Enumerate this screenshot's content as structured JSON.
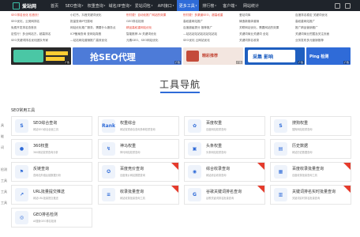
{
  "nav": {
    "logo": "爱站网",
    "items": [
      {
        "label": "首页",
        "active": false,
        "caret": false
      },
      {
        "label": "SEO查询",
        "active": false,
        "caret": true
      },
      {
        "label": "权重查询",
        "active": false,
        "caret": true
      },
      {
        "label": "域名/IP查询",
        "active": false,
        "caret": true
      },
      {
        "label": "爱站词包",
        "active": false,
        "caret": true
      },
      {
        "label": "API接口",
        "active": false,
        "caret": true
      },
      {
        "label": "更多工具",
        "active": true,
        "caret": true
      },
      {
        "label": "排行榜",
        "active": false,
        "caret": true
      },
      {
        "label": "客户端",
        "active": false,
        "caret": true
      },
      {
        "label": "网站统计",
        "active": false,
        "caret": false
      }
    ]
  },
  "link_columns": [
    [
      "SEO排名优化 包首页！",
      "SEO优化，云竞网排名",
      "免费开发排名查首页",
      "定性行！多业网站方，超高排名",
      "SEO关键词排名优化团队专家"
    ],
    [
      "小红书，抖音关键词优化",
      "批量查询IP归属地",
      "网站优化推广服务，需要什么服务点",
      "ICP备案查询 查网站真假",
      "—站站网站营销推广高效优化"
    ],
    [
      "别付费！自动化推广网站的效果",
      "GEO排名检测",
      "精品高权重网站优化",
      "智能推荐 AI 关键词优化",
      "元素GEO、SEO网站优化"
    ],
    [
      "别付费！多渠道SEO，超高权重",
      "高权重网站推广",
      "百度超级提分 推荐推广",
      "—站站站站站站站站站站站",
      "SEO优化 云网站优化"
    ],
    [
      "爱站词库",
      "铸造新媒体营销",
      "关联网站优化，需要网站的效果",
      "关键词商业关键词 全站",
      "关键词排名收录"
    ],
    [
      "百度排名稳定 关键词优化",
      "高权重网站推广",
      "推广精品营销推广",
      "关键词商业挖掘及关注页面",
      "业务发布多元营销推荐"
    ]
  ],
  "banners": [
    {
      "text": "",
      "tag": "广告"
    },
    {
      "text": "抢SEO代理",
      "tag": "广告"
    },
    {
      "text": "精彩推荐",
      "tag": "广告"
    },
    {
      "text": "采集 影响",
      "tag": "广告"
    },
    {
      "text": "Ping 检测",
      "tag": "广告"
    }
  ],
  "page_title": "工具导航",
  "section_title": "SEO常用工具",
  "sidebar": [
    "具",
    "能",
    "词",
    "",
    "检测",
    "工具",
    "工具",
    "工具"
  ],
  "cards": [
    {
      "name": "SEO综合查询",
      "desc": "网站SEO综合全面工具",
      "icon": "S",
      "corner": false
    },
    {
      "name": "权重综合",
      "desc": "网站权重综合查询多种权重查询",
      "icon": "Rank",
      "corner": false
    },
    {
      "name": "百度权重",
      "desc": "百度网站权重查询",
      "icon": "✿",
      "corner": false
    },
    {
      "name": "搜狗权重",
      "desc": "搜狗网站权重查询",
      "icon": "S",
      "corner": false
    },
    {
      "name": "360权重",
      "desc": "360网站权重查询分析",
      "icon": "●",
      "corner": false
    },
    {
      "name": "神马权重",
      "desc": "神马网站权重查询",
      "icon": "↯",
      "corner": false
    },
    {
      "name": "头条权重",
      "desc": "头条网站权重查询",
      "icon": "▣",
      "corner": false
    },
    {
      "name": "历史数据",
      "desc": "网站历史数据查询",
      "icon": "▤",
      "corner": false
    },
    {
      "name": "反链查询",
      "desc": "查网站外链反链数据分析",
      "icon": "⚑",
      "corner": false
    },
    {
      "name": "百度竞价查询",
      "desc": "百度竞价网站数据查询",
      "icon": "✪",
      "corner": true
    },
    {
      "name": "综合收录查询",
      "desc": "网站综合收录查询",
      "icon": "◉",
      "corner": true
    },
    {
      "name": "百度收录批量查询",
      "desc": "百度收录批量查询工具",
      "icon": "▦",
      "corner": true
    },
    {
      "name": "URL批量提交推送",
      "desc": "网站URL批量提交推送",
      "icon": "↗",
      "corner": false
    },
    {
      "name": "收录批量查询",
      "desc": "网站收录批量查询工具",
      "icon": "≡",
      "corner": true
    },
    {
      "name": "谷歌关键词排名查询",
      "desc": "谷歌关键词排名批量查询",
      "icon": "G",
      "corner": true
    },
    {
      "name": "关键词排名实时批量查询",
      "desc": "关键词实时排名批量查询",
      "icon": "▥",
      "corner": true
    },
    {
      "name": "GEO排名检测",
      "desc": "AI搜索GEO排名检测",
      "icon": "◎",
      "corner": false
    }
  ]
}
